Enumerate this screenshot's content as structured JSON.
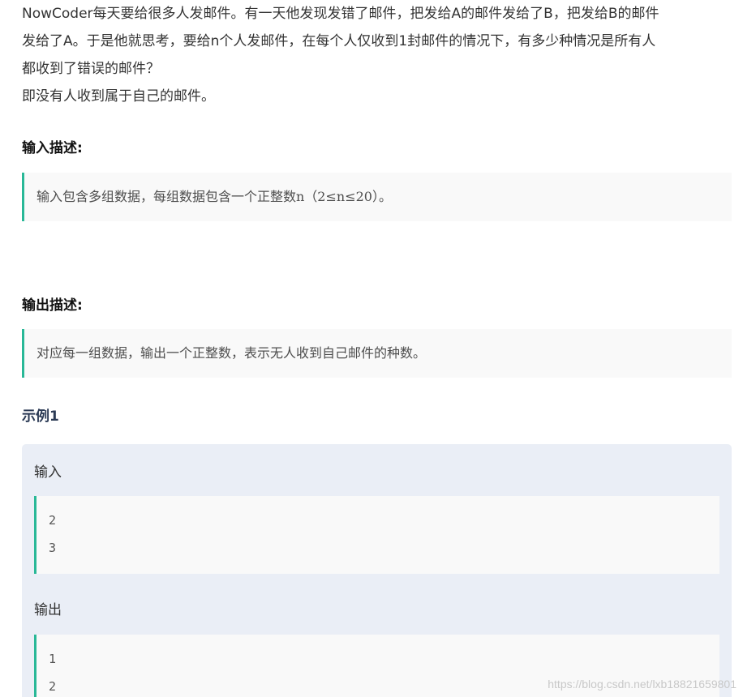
{
  "problem": {
    "description_lines": [
      "NowCoder每天要给很多人发邮件。有一天他发现发错了邮件，把发给A的邮件发给了B，把发给B的邮件",
      "发给了A。于是他就思考，要给n个人发邮件，在每个人仅收到1封邮件的情况下，有多少种情况是所有人",
      "都收到了错误的邮件？",
      "即没有人收到属于自己的邮件。"
    ],
    "input_heading": "输入描述:",
    "input_text": "输入包含多组数据，每组数据包含一个正整数n（2≤n≤20）。",
    "output_heading": "输出描述:",
    "output_text": "对应每一组数据，输出一个正整数，表示无人收到自己邮件的种数。",
    "example_heading": "示例1",
    "example": {
      "input_label": "输入",
      "input_lines": [
        "2",
        "3"
      ],
      "output_label": "输出",
      "output_lines": [
        "1",
        "2"
      ]
    }
  },
  "watermark": "https://blog.csdn.net/lxb18821659801",
  "colors": {
    "accent_border": "#29b897",
    "quote_bg": "#f9f9f9",
    "example_bg": "#eaeef6"
  }
}
